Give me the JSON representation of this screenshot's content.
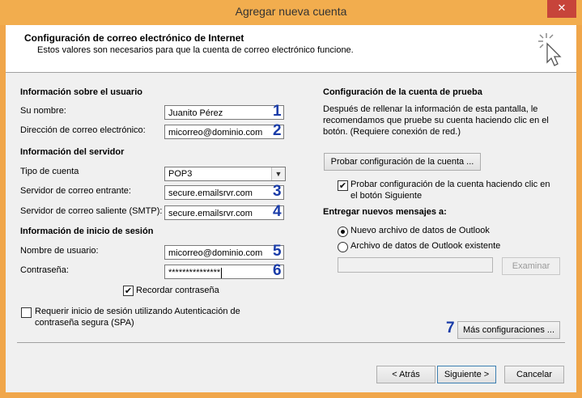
{
  "window": {
    "title": "Agregar nueva cuenta",
    "close_glyph": "✕"
  },
  "header": {
    "title": "Configuración de correo electrónico de Internet",
    "subtitle": "Estos valores son necesarios para que la cuenta de correo electrónico funcione.",
    "icon": "cursor-click-icon"
  },
  "user_info": {
    "heading": "Información sobre el usuario",
    "name_label": "Su nombre:",
    "name_value": "Juanito Pérez",
    "name_num": "1",
    "email_label": "Dirección de correo electrónico:",
    "email_value": "micorreo@dominio.com",
    "email_num": "2"
  },
  "server_info": {
    "heading": "Información del servidor",
    "type_label": "Tipo de cuenta",
    "type_value": "POP3",
    "incoming_label": "Servidor de correo entrante:",
    "incoming_value": "secure.emailsrvr.com",
    "incoming_num": "3",
    "outgoing_label": "Servidor de correo saliente (SMTP):",
    "outgoing_value": "secure.emailsrvr.com",
    "outgoing_num": "4"
  },
  "login_info": {
    "heading": "Información de inicio de sesión",
    "user_label": "Nombre de usuario:",
    "user_value": "micorreo@dominio.com",
    "user_num": "5",
    "pwd_label": "Contraseña:",
    "pwd_value": "***************",
    "pwd_num": "6",
    "remember_label": "Recordar contraseña",
    "remember_checked": true,
    "spa_label_1": "Requerir inicio de sesión utilizando Autenticación de",
    "spa_label_2": "contraseña segura (SPA)",
    "spa_checked": false
  },
  "test": {
    "heading": "Configuración de la cuenta de prueba",
    "desc_1": "Después de rellenar la información de esta pantalla, le",
    "desc_2": "recomendamos que pruebe su cuenta haciendo clic en el",
    "desc_3": "botón. (Requiere conexión de red.)",
    "test_button": "Probar configuración de la cuenta ...",
    "auto_test_label_1": "Probar configuración de la cuenta haciendo clic en",
    "auto_test_label_2": "el botón Siguiente",
    "auto_test_checked": true
  },
  "delivery": {
    "heading": "Entregar nuevos mensajes a:",
    "opt_new": "Nuevo archivo de datos de Outlook",
    "opt_existing": "Archivo de datos de Outlook existente",
    "selected": "new",
    "path_value": "",
    "browse_button": "Examinar"
  },
  "more": {
    "num": "7",
    "button": "Más configuraciones ..."
  },
  "footer": {
    "back": "< Atrás",
    "next": "Siguiente >",
    "cancel": "Cancelar"
  }
}
